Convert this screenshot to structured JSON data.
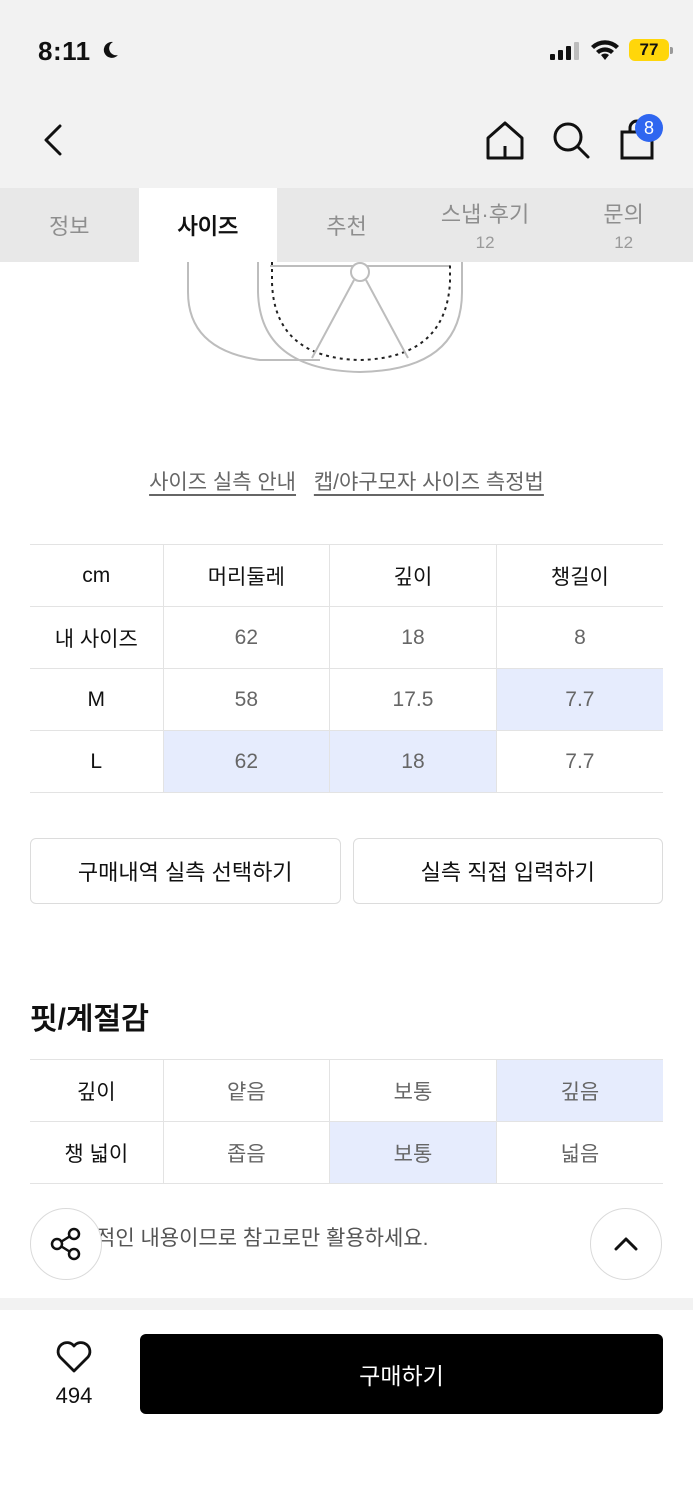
{
  "status_bar": {
    "time": "8:11",
    "battery": "77"
  },
  "header": {
    "cart_count": "8"
  },
  "tabs": [
    {
      "label": "정보",
      "count": ""
    },
    {
      "label": "사이즈",
      "count": ""
    },
    {
      "label": "추천",
      "count": ""
    },
    {
      "label": "스냅·후기",
      "count": "12"
    },
    {
      "label": "문의",
      "count": "12"
    }
  ],
  "links": {
    "size_guide": "사이즈 실측 안내",
    "measure_guide": "캡/야구모자 사이즈 측정법"
  },
  "size_table": {
    "headers": [
      "cm",
      "머리둘레",
      "깊이",
      "챙길이"
    ],
    "rows": [
      {
        "label": "내 사이즈",
        "values": [
          "62",
          "18",
          "8"
        ]
      },
      {
        "label": "M",
        "values": [
          "58",
          "17.5",
          "7.7"
        ]
      },
      {
        "label": "L",
        "values": [
          "62",
          "18",
          "7.7"
        ]
      }
    ]
  },
  "buttons": {
    "select_history": "구매내역 실측 선택하기",
    "direct_input": "실측 직접 입력하기"
  },
  "fit_section": {
    "title": "핏/계절감",
    "rows": [
      {
        "label": "깊이",
        "options": [
          "얕음",
          "보통",
          "깊음"
        ]
      },
      {
        "label": "챙 넓이",
        "options": [
          "좁음",
          "보통",
          "넓음"
        ]
      }
    ]
  },
  "note": "적인 내용이므로 참고로만 활용하세요.",
  "bottom": {
    "like_count": "494",
    "buy_label": "구매하기"
  },
  "colors": {
    "highlight": "#e6ecfd",
    "badge": "#2f66f0",
    "buy_button": "#000000"
  }
}
